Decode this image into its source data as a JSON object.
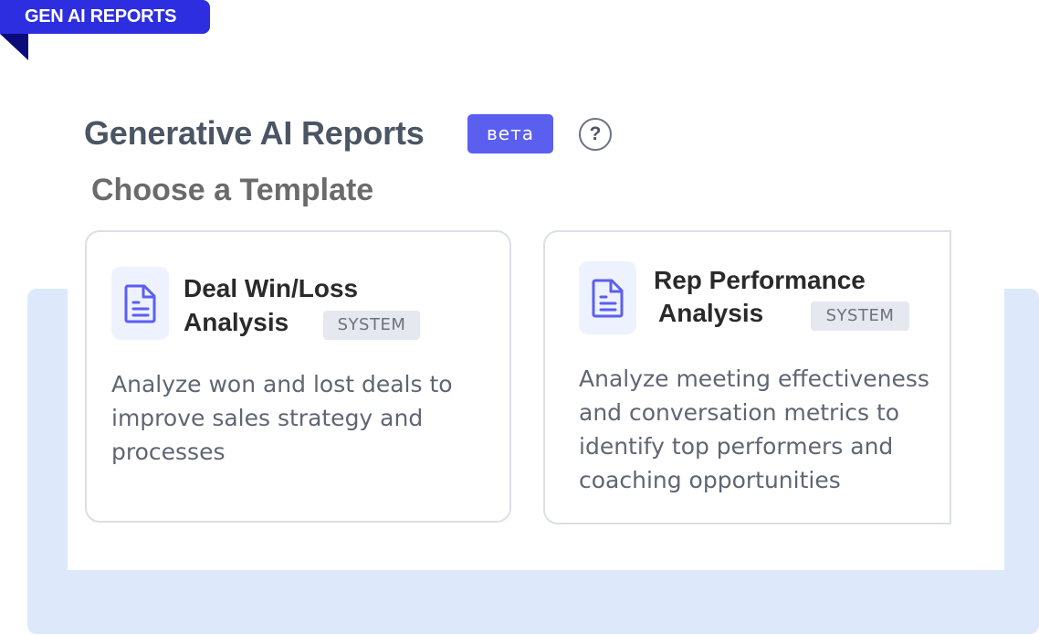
{
  "ribbon": {
    "label": "GEN AI REPORTS"
  },
  "header": {
    "title": "Generative AI Reports",
    "beta_badge": "вета",
    "help_icon": "?",
    "subtitle": "Choose a Template"
  },
  "colors": {
    "ribbon": "#2d2ee0",
    "ribbon_fold": "#0b0b7a",
    "beta_badge": "#5b5ff0",
    "accent_icon": "#5b5ff0",
    "background_band": "#dde9fb"
  },
  "templates": [
    {
      "icon": "document-icon",
      "title_line1": "Deal Win/Loss",
      "title_line2": "Analysis",
      "badge": "SYSTEM",
      "description": "Analyze won and lost deals to improve sales strategy and processes"
    },
    {
      "icon": "document-icon",
      "title_line1": "Rep Performance",
      "title_line2": "Analysis",
      "badge": "SYSTEM",
      "description": "Analyze meeting effectiveness and conversation metrics to identify top performers and coaching opportunities"
    }
  ]
}
